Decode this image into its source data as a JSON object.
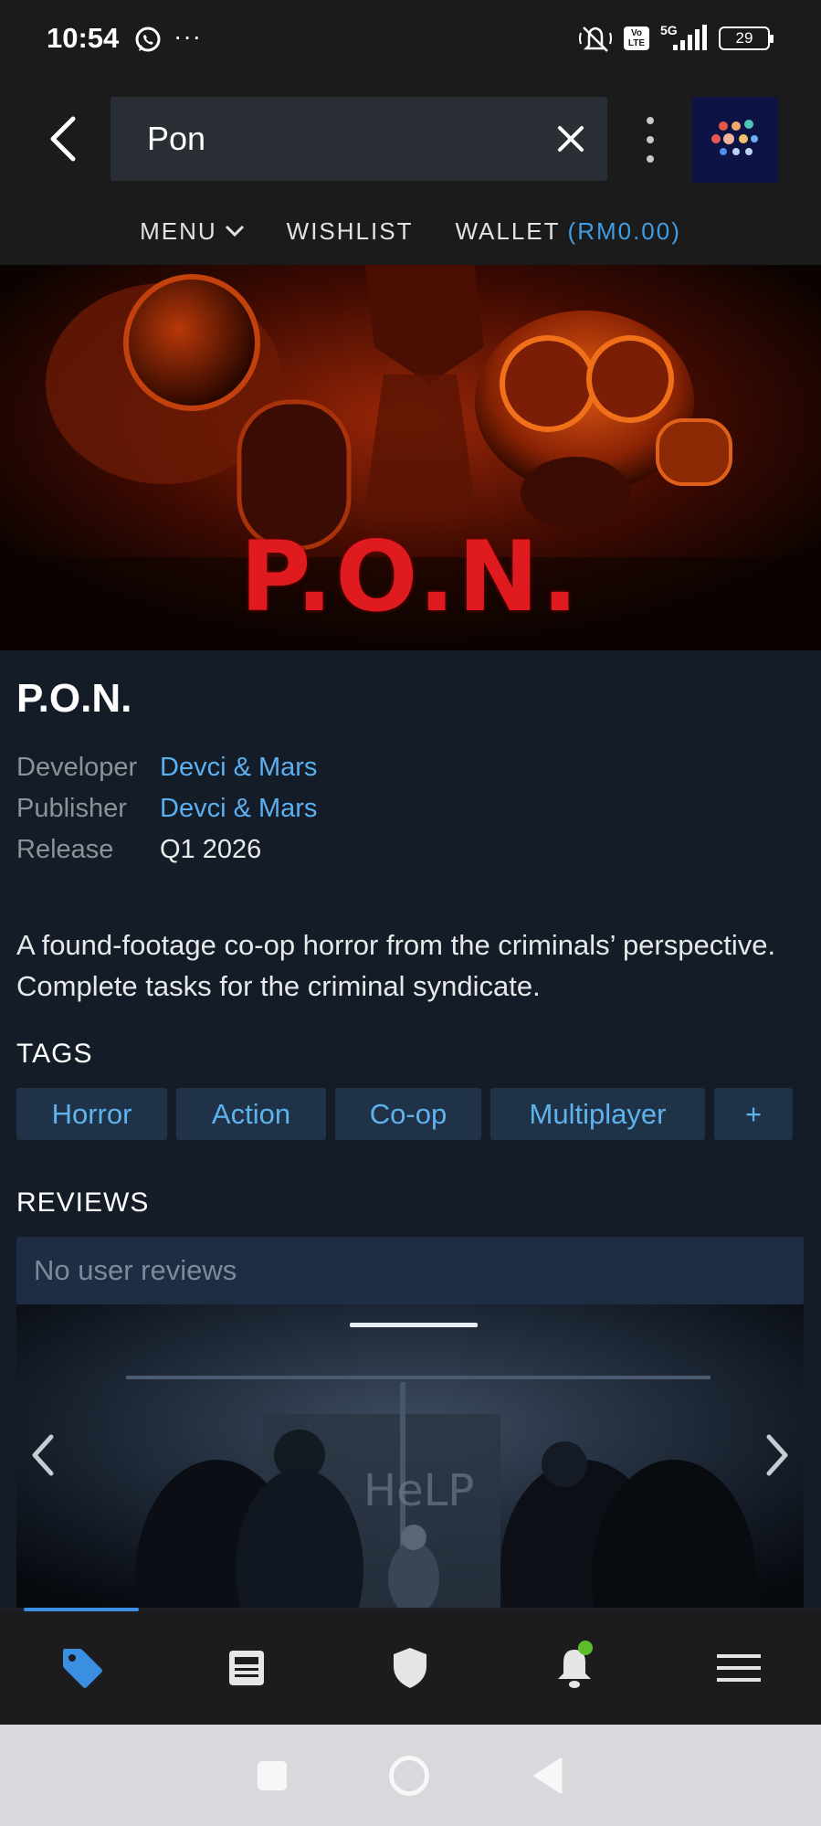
{
  "status_bar": {
    "time": "10:54",
    "more_dots": "···",
    "network": "5G",
    "volte": "Vo LTE",
    "battery": "29",
    "icons": [
      "whatsapp-icon",
      "mute-icon",
      "volte-icon",
      "signal-icon",
      "battery-icon"
    ]
  },
  "header": {
    "search_value": "Pon",
    "subnav": {
      "menu": "MENU",
      "wishlist": "WISHLIST",
      "wallet": "WALLET",
      "wallet_balance": "(RM0.00)"
    }
  },
  "game": {
    "hero_logo": "P.O.N.",
    "title": "P.O.N.",
    "meta": [
      {
        "label": "Developer",
        "value": "Devci & Mars"
      },
      {
        "label": "Publisher",
        "value": "Devci & Mars"
      },
      {
        "label": "Release",
        "value": "Q1 2026"
      }
    ],
    "description": "A found-footage co-op horror from the criminals’ perspective. Complete tasks for the criminal syndicate.",
    "tags_title": "TAGS",
    "tags": [
      "Horror",
      "Action",
      "Co-op",
      "Multiplayer",
      "+"
    ],
    "reviews_title": "REVIEWS",
    "reviews_text": "No user reviews",
    "screenshot_wall_text": "HeLP"
  },
  "screenshot_carousel": {
    "progress_fraction": 0.14
  },
  "tabbar": {
    "items": [
      "store-tag-icon",
      "news-icon",
      "shield-icon",
      "bell-icon",
      "hamburger-menu-icon"
    ],
    "active_index": 0,
    "active_color": "#3b8fe0"
  },
  "colors": {
    "link": "#5ab0f0",
    "accent_blue": "#3d9ee8",
    "hero_red": "#e01b1f",
    "background": "#141c28"
  }
}
